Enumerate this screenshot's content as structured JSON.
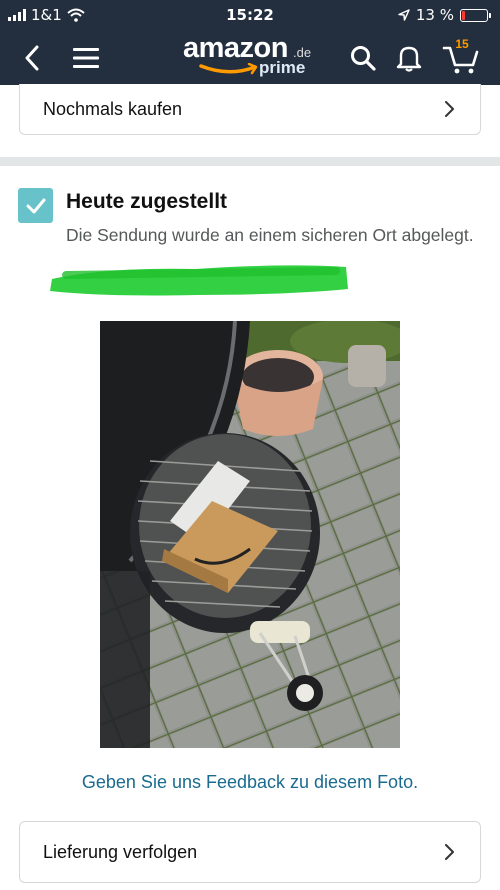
{
  "status_bar": {
    "carrier": "1&1",
    "time": "15:22",
    "battery": "13 %",
    "battery_level": 0.13
  },
  "nav": {
    "logo_main": "amazon",
    "logo_domain": ".de",
    "logo_sub": "prime",
    "cart_count": "15"
  },
  "buy_again": {
    "label": "Nochmals kaufen"
  },
  "delivery": {
    "title": "Heute zugestellt",
    "description": "Die Sendung wurde an einem sicheren Ort abgelegt."
  },
  "photo": {
    "feedback_link": "Geben Sie uns Feedback zu diesem Foto."
  },
  "track": {
    "label": "Lieferung verfolgen"
  },
  "colors": {
    "nav_background": "#232f3e",
    "check_teal": "#67c3c9",
    "link_blue": "#1a6b8f",
    "highlighter_green": "#22cc33",
    "battery_red": "#ff3b30",
    "cart_orange": "#ff9900"
  },
  "icons": [
    "signal-icon",
    "wifi-icon",
    "location-arrow-icon",
    "battery-icon",
    "back-chevron-icon",
    "menu-icon",
    "search-icon",
    "bell-icon",
    "cart-icon",
    "chevron-right-icon",
    "checkmark-icon"
  ]
}
